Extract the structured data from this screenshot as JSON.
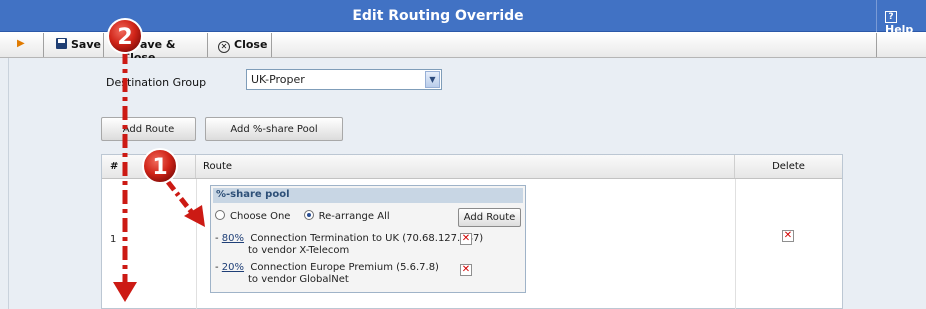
{
  "window": {
    "title": "Edit Routing Override",
    "help_label": "Help"
  },
  "toolbar": {
    "save_label": "Save",
    "save_close_label": "ave & Close",
    "close_label": "Close"
  },
  "form": {
    "destination_group_label": "Destination Group",
    "destination_group_value": "UK-Proper"
  },
  "buttons": {
    "add_route": "Add Route",
    "add_pool": "Add %-share Pool"
  },
  "table": {
    "columns": [
      "#",
      "Route",
      "Delete"
    ],
    "rows": [
      {
        "num": "1",
        "pool": {
          "title": "%-share pool",
          "option_choose_one": "Choose One",
          "option_rearrange_all": "Re-arrange All",
          "selected_option": "Re-arrange All",
          "add_route_label": "Add Route",
          "entries": [
            {
              "prefix": "- ",
              "percent": "80%",
              "line1": "Connection Termination to UK (70.68.127.187)",
              "line2": "to vendor X-Telecom"
            },
            {
              "prefix": "- ",
              "percent": "20%",
              "line1": "Connection Europe Premium (5.6.7.8)",
              "line2": "to vendor GlobalNet"
            }
          ]
        }
      }
    ]
  },
  "annotations": {
    "badge_1": "1",
    "badge_2": "2"
  },
  "colors": {
    "title_bar": "#4172c4",
    "annotation_red": "#cc1a14",
    "delete_red": "#d20000"
  }
}
